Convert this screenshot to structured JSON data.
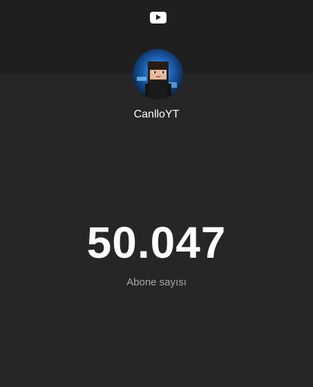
{
  "header": {
    "icon": "youtube-icon"
  },
  "channel": {
    "name": "CanlloYT",
    "avatar": "channel-avatar"
  },
  "stats": {
    "subscriber_count": "50.047",
    "subscriber_label": "Abone sayısı"
  },
  "colors": {
    "background": "#262626",
    "header_band": "#1f1f1f",
    "text_primary": "#ffffff",
    "text_secondary": "#a8a8a8"
  }
}
